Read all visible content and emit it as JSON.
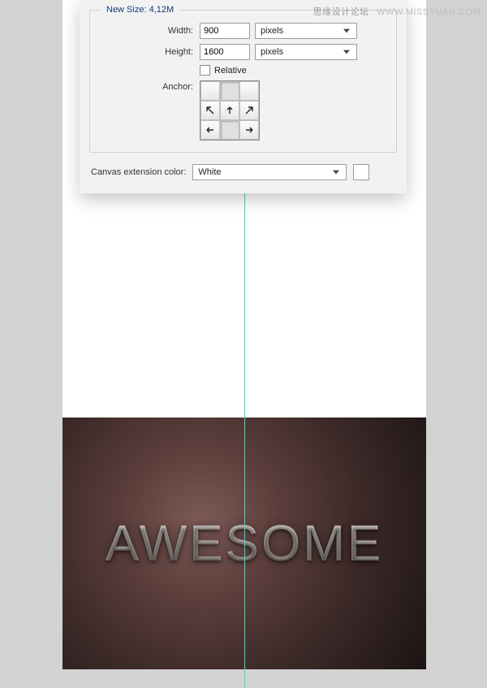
{
  "watermark": {
    "cn": "思缘设计论坛",
    "url": "WWW.MISSYUAN.COM"
  },
  "dialog": {
    "legend": "New Size: 4,12M",
    "width_label": "Width:",
    "width_value": "900",
    "width_unit": "pixels",
    "height_label": "Height:",
    "height_value": "1600",
    "height_unit": "pixels",
    "relative_label": "Relative",
    "anchor_label": "Anchor:",
    "ext_label": "Canvas extension color:",
    "ext_value": "White",
    "swatch_color": "#ffffff"
  },
  "anchor": {
    "selected": "top-center",
    "arrows": [
      "",
      "",
      "",
      "↖",
      "↑",
      "↗",
      "←",
      "·",
      "→"
    ]
  },
  "art": {
    "text": "AWESOME"
  }
}
